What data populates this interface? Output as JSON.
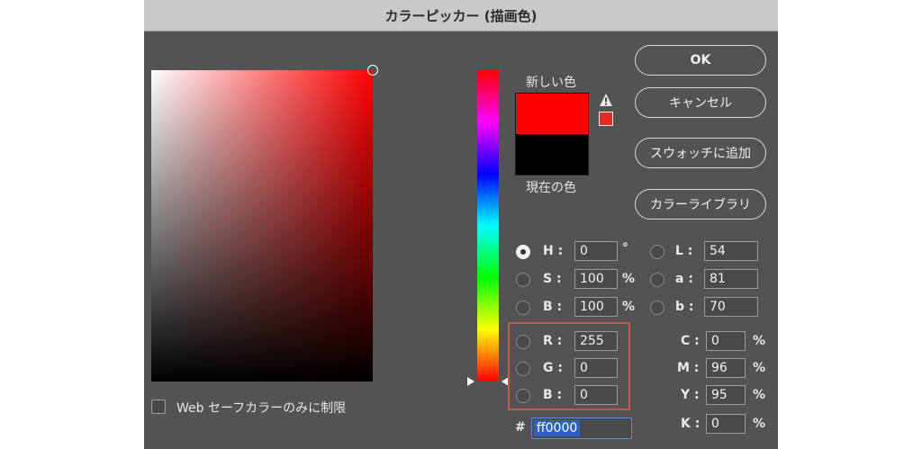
{
  "window": {
    "title": "カラーピッカー (描画色)"
  },
  "swatches": {
    "new_label": "新しい色",
    "current_label": "現在の色",
    "new_color": "#ff0000",
    "current_color": "#000000",
    "gamut_color": "#e62b1e"
  },
  "buttons": {
    "ok": "OK",
    "cancel": "キャンセル",
    "add_swatch": "スウォッチに追加",
    "libraries": "カラーライブラリ"
  },
  "hsb": {
    "h": {
      "label": "H :",
      "value": "0",
      "unit": "°"
    },
    "s": {
      "label": "S :",
      "value": "100",
      "unit": "%"
    },
    "b": {
      "label": "B :",
      "value": "100",
      "unit": "%"
    }
  },
  "lab": {
    "l": {
      "label": "L :",
      "value": "54"
    },
    "a": {
      "label": "a :",
      "value": "81"
    },
    "b": {
      "label": "b :",
      "value": "70"
    }
  },
  "rgb": {
    "r": {
      "label": "R :",
      "value": "255"
    },
    "g": {
      "label": "G :",
      "value": "0"
    },
    "b": {
      "label": "B :",
      "value": "0"
    }
  },
  "cmyk": {
    "c": {
      "label": "C :",
      "value": "0",
      "unit": "%"
    },
    "m": {
      "label": "M :",
      "value": "96",
      "unit": "%"
    },
    "y": {
      "label": "Y :",
      "value": "95",
      "unit": "%"
    },
    "k": {
      "label": "K :",
      "value": "0",
      "unit": "%"
    }
  },
  "hex": {
    "label": "#",
    "value": "ff0000"
  },
  "web_safe": {
    "label": "Web セーフカラーのみに制限",
    "checked": false
  },
  "selected_mode": "H"
}
